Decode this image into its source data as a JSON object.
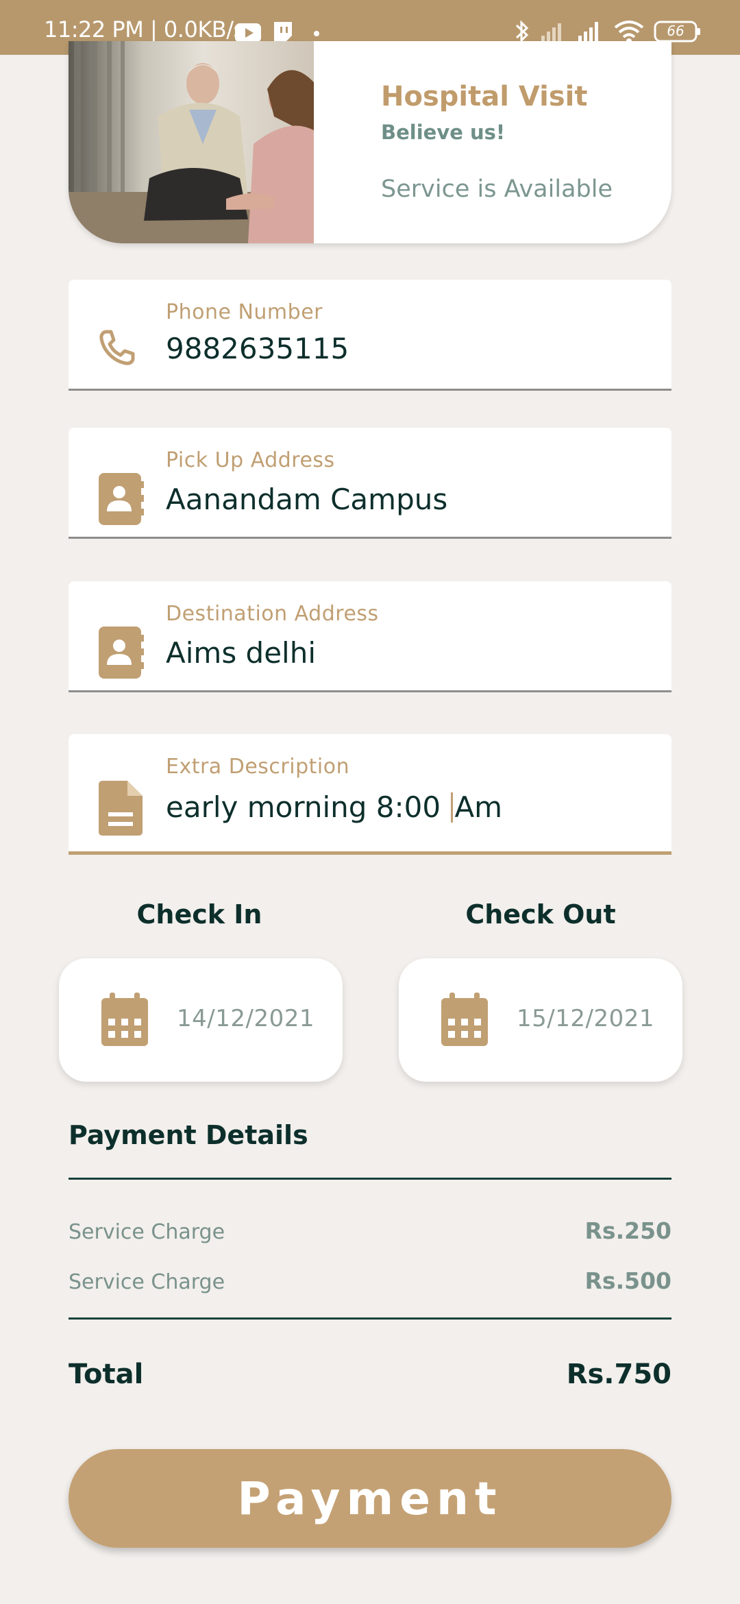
{
  "status_bar": {
    "time": "11:22 PM | 0.0KB/s",
    "battery": "66",
    "icons": [
      "youtube-icon",
      "twitch-icon",
      "notification-dot",
      "bluetooth-icon",
      "signal-weak-icon",
      "signal-icon",
      "wifi-icon",
      "battery-icon"
    ]
  },
  "hero": {
    "title": "Hospital Visit",
    "subtitle": "Believe us!",
    "availability": "Service is Available"
  },
  "form": {
    "phone": {
      "label": "Phone Number",
      "value": "9882635115",
      "icon": "phone-icon"
    },
    "pickup": {
      "label": "Pick Up Address",
      "value": "Aanandam Campus",
      "icon": "contact-book-icon"
    },
    "destination": {
      "label": "Destination Address",
      "value": "Aims delhi",
      "icon": "contact-book-icon"
    },
    "description": {
      "label": "Extra Description",
      "value_before_caret": "early morning 8:00 ",
      "value_after_caret": "Am",
      "icon": "document-icon"
    }
  },
  "dates": {
    "check_in": {
      "label": "Check In",
      "date": "14/12/2021",
      "icon": "calendar-icon"
    },
    "check_out": {
      "label": "Check Out",
      "date": "15/12/2021",
      "icon": "calendar-icon"
    }
  },
  "payment_details": {
    "title": "Payment Details",
    "items": [
      {
        "label": "Service Charge",
        "amount": "Rs.250"
      },
      {
        "label": "Service Charge",
        "amount": "Rs.500"
      }
    ],
    "total_label": "Total",
    "total_amount": "Rs.750"
  },
  "payment_button": {
    "label": "Payment"
  },
  "colors": {
    "accent": "#c09f73",
    "status_bar": "#b7986d",
    "dark_text": "#0d2f2c",
    "muted_text": "#7a928c",
    "background": "#f2efec"
  }
}
